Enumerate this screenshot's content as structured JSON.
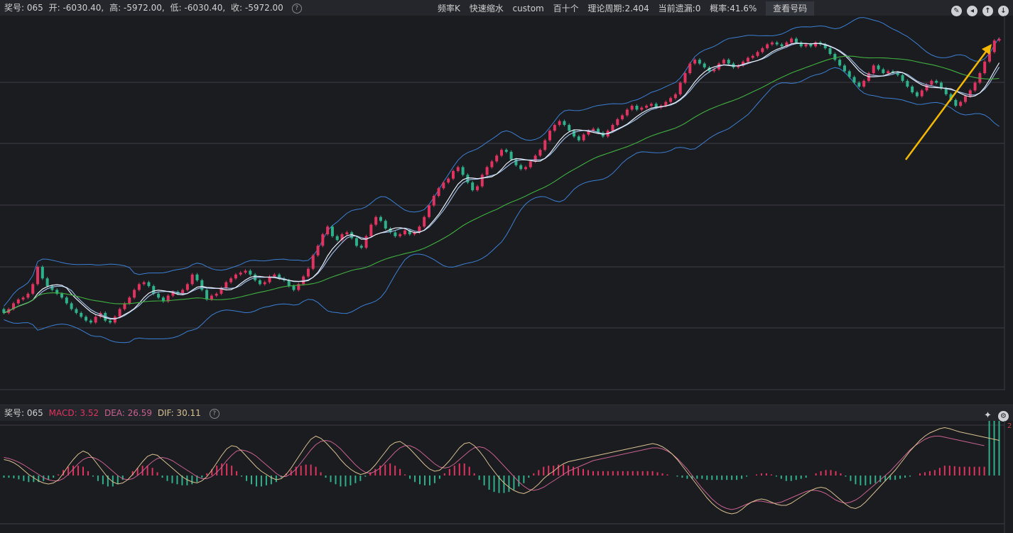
{
  "topbar": {
    "prize_label": "奖号: 065",
    "open": "开: -6030.40,",
    "high": "高: -5972.00,",
    "low": "低: -6030.40,",
    "close": "收: -5972.00",
    "mode": "频率K",
    "zoom": "快速缩水",
    "custom": "custom",
    "digits": "百十个",
    "period": "理论周期:2.404",
    "missing": "当前遗漏:0",
    "probability": "概率:41.6%",
    "view_button": "查看号码"
  },
  "subbar": {
    "prize_label": "奖号: 065",
    "macd": "MACD: 3.52",
    "dea": "DEA: 26.59",
    "dif": "DIF: 30.11"
  },
  "right_axis": {
    "top_main": "",
    "top_macd": "2"
  },
  "colors": {
    "background": "#1b1c20",
    "up_candle": "#e0335f",
    "down_candle": "#2eb08a",
    "ma_white": "#e8eef8",
    "ma_blue": "#9ab8e0",
    "ma_green": "#40b040",
    "bollinger": "#3b7fd4",
    "arrow": "#f5b800",
    "dif_line": "#d8c090",
    "dea_line": "#c86090"
  },
  "chart_data": [
    {
      "type": "candlestick",
      "title": "",
      "series_note": "",
      "x_count": 205,
      "ylim": [
        -7800,
        -5850
      ],
      "close": [
        -7400,
        -7380,
        -7350,
        -7330,
        -7320,
        -7300,
        -7250,
        -7160,
        -7220,
        -7260,
        -7280,
        -7300,
        -7320,
        -7350,
        -7380,
        -7400,
        -7420,
        -7440,
        -7450,
        -7420,
        -7400,
        -7440,
        -7450,
        -7420,
        -7380,
        -7350,
        -7320,
        -7280,
        -7250,
        -7240,
        -7260,
        -7300,
        -7320,
        -7340,
        -7310,
        -7290,
        -7300,
        -7280,
        -7250,
        -7200,
        -7230,
        -7280,
        -7330,
        -7310,
        -7300,
        -7270,
        -7240,
        -7220,
        -7200,
        -7190,
        -7180,
        -7200,
        -7230,
        -7250,
        -7240,
        -7210,
        -7200,
        -7220,
        -7230,
        -7260,
        -7280,
        -7250,
        -7210,
        -7170,
        -7100,
        -7050,
        -6990,
        -6950,
        -7000,
        -7020,
        -6990,
        -6980,
        -7010,
        -7050,
        -7060,
        -7000,
        -6940,
        -6900,
        -6920,
        -6960,
        -6980,
        -7000,
        -6990,
        -6970,
        -6990,
        -6980,
        -6950,
        -6900,
        -6840,
        -6790,
        -6750,
        -6720,
        -6700,
        -6660,
        -6640,
        -6680,
        -6720,
        -6760,
        -6740,
        -6680,
        -6640,
        -6610,
        -6580,
        -6550,
        -6560,
        -6600,
        -6630,
        -6650,
        -6640,
        -6610,
        -6580,
        -6550,
        -6500,
        -6450,
        -6420,
        -6400,
        -6420,
        -6450,
        -6480,
        -6500,
        -6470,
        -6450,
        -6440,
        -6460,
        -6480,
        -6450,
        -6420,
        -6390,
        -6370,
        -6340,
        -6320,
        -6340,
        -6330,
        -6320,
        -6310,
        -6330,
        -6320,
        -6300,
        -6280,
        -6260,
        -6200,
        -6150,
        -6100,
        -6080,
        -6100,
        -6120,
        -6140,
        -6130,
        -6100,
        -6080,
        -6100,
        -6120,
        -6110,
        -6090,
        -6070,
        -6060,
        -6040,
        -6020,
        -6000,
        -5990,
        -6000,
        -6010,
        -5990,
        -5970,
        -5990,
        -6010,
        -6000,
        -6010,
        -5990,
        -6000,
        -6020,
        -6050,
        -6080,
        -6110,
        -6140,
        -6170,
        -6200,
        -6220,
        -6190,
        -6150,
        -6110,
        -6130,
        -6150,
        -6140,
        -6150,
        -6160,
        -6190,
        -6220,
        -6250,
        -6270,
        -6240,
        -6210,
        -6190,
        -6200,
        -6230,
        -6260,
        -6290,
        -6320,
        -6300,
        -6270,
        -6240,
        -6200,
        -6150,
        -6090,
        -6040,
        -5980,
        -5972
      ]
    },
    {
      "type": "macd",
      "title": "",
      "x_count": 205,
      "ylim": [
        -90,
        90
      ],
      "dif": [
        30,
        28,
        24,
        18,
        10,
        2,
        -4,
        -10,
        -14,
        -16,
        -14,
        -8,
        4,
        18,
        30,
        40,
        46,
        42,
        32,
        20,
        8,
        -4,
        -12,
        -16,
        -14,
        -8,
        2,
        14,
        26,
        36,
        40,
        38,
        30,
        22,
        14,
        6,
        -2,
        -8,
        -12,
        -14,
        -10,
        -2,
        10,
        24,
        38,
        50,
        56,
        54,
        46,
        36,
        26,
        16,
        8,
        2,
        -4,
        -8,
        -6,
        2,
        14,
        28,
        42,
        56,
        68,
        74,
        70,
        62,
        52,
        42,
        30,
        20,
        12,
        6,
        2,
        4,
        10,
        20,
        32,
        44,
        56,
        62,
        64,
        58,
        50,
        40,
        30,
        20,
        12,
        8,
        10,
        18,
        28,
        40,
        52,
        60,
        62,
        56,
        46,
        34,
        20,
        8,
        -4,
        -14,
        -22,
        -28,
        -32,
        -34,
        -30,
        -24,
        -16,
        -6,
        2,
        8,
        16,
        22,
        26,
        28,
        30,
        32,
        34,
        36,
        38,
        40,
        42,
        44,
        46,
        48,
        50,
        52,
        54,
        56,
        58,
        60,
        58,
        54,
        48,
        40,
        30,
        18,
        6,
        -6,
        -18,
        -30,
        -42,
        -52,
        -60,
        -66,
        -70,
        -72,
        -70,
        -64,
        -56,
        -50,
        -46,
        -44,
        -46,
        -50,
        -54,
        -56,
        -56,
        -52,
        -46,
        -40,
        -34,
        -28,
        -24,
        -22,
        -24,
        -30,
        -38,
        -46,
        -54,
        -60,
        -62,
        -58,
        -50,
        -40,
        -30,
        -20,
        -10,
        0,
        10,
        22,
        34,
        46,
        56,
        66,
        74,
        80,
        84,
        88,
        90,
        88,
        85,
        82,
        80,
        78,
        76,
        74,
        72,
        70,
        68,
        66
      ],
      "dea": [
        34,
        32,
        29,
        25,
        20,
        14,
        8,
        2,
        -4,
        -8,
        -10,
        -10,
        -6,
        2,
        12,
        22,
        30,
        34,
        34,
        30,
        24,
        16,
        8,
        0,
        -6,
        -8,
        -6,
        0,
        8,
        18,
        26,
        32,
        34,
        32,
        28,
        22,
        16,
        10,
        4,
        -2,
        -6,
        -6,
        -2,
        6,
        16,
        28,
        38,
        46,
        48,
        46,
        42,
        36,
        28,
        20,
        12,
        4,
        -2,
        -2,
        4,
        12,
        24,
        36,
        48,
        58,
        64,
        66,
        64,
        58,
        50,
        40,
        30,
        20,
        12,
        6,
        4,
        8,
        14,
        24,
        34,
        44,
        52,
        56,
        56,
        52,
        46,
        38,
        30,
        22,
        16,
        14,
        16,
        22,
        30,
        38,
        46,
        52,
        54,
        52,
        46,
        38,
        28,
        18,
        8,
        -2,
        -12,
        -20,
        -26,
        -28,
        -26,
        -22,
        -16,
        -10,
        -4,
        2,
        8,
        12,
        16,
        20,
        24,
        28,
        30,
        32,
        34,
        36,
        38,
        40,
        42,
        44,
        46,
        48,
        50,
        52,
        52,
        50,
        46,
        40,
        32,
        22,
        12,
        0,
        -12,
        -24,
        -34,
        -44,
        -52,
        -58,
        -62,
        -64,
        -62,
        -58,
        -54,
        -50,
        -48,
        -48,
        -50,
        -52,
        -52,
        -50,
        -46,
        -42,
        -38,
        -34,
        -30,
        -28,
        -28,
        -30,
        -34,
        -40,
        -46,
        -50,
        -52,
        -50,
        -46,
        -40,
        -32,
        -24,
        -16,
        -8,
        0,
        8,
        18,
        28,
        38,
        48,
        56,
        62,
        68,
        72,
        74,
        74,
        72,
        70,
        68,
        66,
        64,
        62,
        60,
        58,
        56
      ]
    }
  ]
}
